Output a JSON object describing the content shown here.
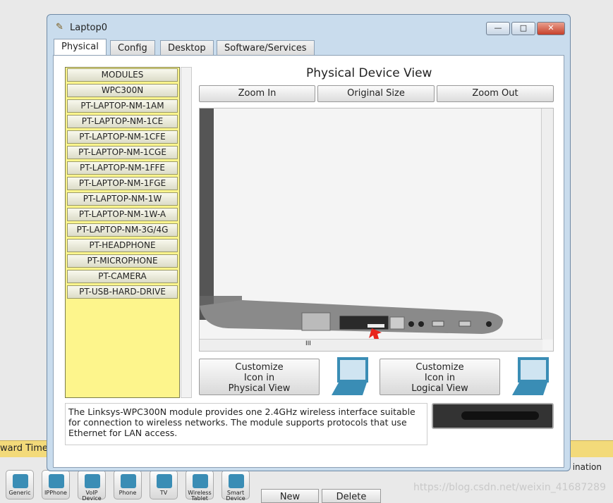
{
  "window": {
    "title": "Laptop0",
    "minimize": "—",
    "maximize": "□",
    "close": "✕"
  },
  "tabs": [
    {
      "label": "Physical",
      "active": true
    },
    {
      "label": "Config"
    },
    {
      "label": "Desktop"
    },
    {
      "label": "Software/Services"
    }
  ],
  "modules": [
    "MODULES",
    "WPC300N",
    "PT-LAPTOP-NM-1AM",
    "PT-LAPTOP-NM-1CE",
    "PT-LAPTOP-NM-1CFE",
    "PT-LAPTOP-NM-1CGE",
    "PT-LAPTOP-NM-1FFE",
    "PT-LAPTOP-NM-1FGE",
    "PT-LAPTOP-NM-1W",
    "PT-LAPTOP-NM-1W-A",
    "PT-LAPTOP-NM-3G/4G",
    "PT-HEADPHONE",
    "PT-MICROPHONE",
    "PT-CAMERA",
    "PT-USB-HARD-DRIVE"
  ],
  "view": {
    "title": "Physical Device View",
    "zoom_in": "Zoom In",
    "original_size": "Original Size",
    "zoom_out": "Zoom Out",
    "scroll_grip": "III"
  },
  "customize": {
    "physical": "Customize\nIcon in\nPhysical View",
    "logical": "Customize\nIcon in\nLogical View"
  },
  "description": "The Linksys-WPC300N module provides one 2.4GHz wireless interface suitable for connection to wireless networks. The module supports protocols that use Ethernet for LAN access.",
  "background": {
    "bar_text": "ward Time",
    "dest_text": "ination",
    "devices": [
      "Generic",
      "IPPhone",
      "VoIP Device",
      "Phone",
      "TV",
      "Wireless Tablet",
      "Smart Device"
    ],
    "new": "New",
    "delete": "Delete",
    "watermark": "https://blog.csdn.net/weixin_41687289"
  },
  "colors": {
    "module_list": "#fdf58c",
    "arrow": "#e8251d",
    "accent": "#3a8db5"
  }
}
